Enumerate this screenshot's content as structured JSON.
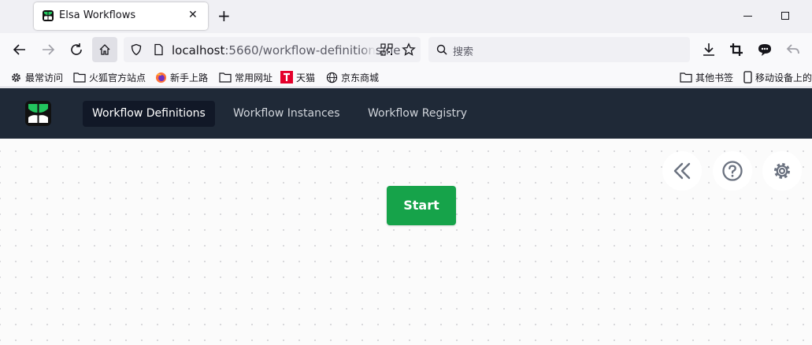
{
  "browser": {
    "tab_title": "Elsa Workflows",
    "tab_close": "✕",
    "new_tab": "+",
    "url_host": "localhost",
    "url_rest": ":5660/workflow-definitions/ne",
    "search_placeholder": "搜索"
  },
  "bookmarks": {
    "left": [
      {
        "label": "最常访问",
        "icon": "gear-icon"
      },
      {
        "label": "火狐官方站点",
        "icon": "folder-icon"
      },
      {
        "label": "新手上路",
        "icon": "firefox-icon"
      },
      {
        "label": "常用网址",
        "icon": "folder-icon"
      },
      {
        "label": "天猫",
        "icon": "tmall-icon"
      },
      {
        "label": "京东商城",
        "icon": "globe-icon"
      }
    ],
    "right": [
      {
        "label": "其他书签",
        "icon": "folder-icon"
      },
      {
        "label": "移动设备上的",
        "icon": "mobile-icon"
      }
    ]
  },
  "app": {
    "nav": [
      {
        "label": "Workflow Definitions",
        "active": true
      },
      {
        "label": "Workflow Instances",
        "active": false
      },
      {
        "label": "Workflow Registry",
        "active": false
      }
    ],
    "designer": {
      "start_label": "Start",
      "tools": [
        "collapse-panel-icon",
        "help-icon",
        "settings-icon"
      ]
    }
  },
  "colors": {
    "app_nav_bg": "#1f2937",
    "active_nav_bg": "#111827",
    "start_node": "#16a34a"
  }
}
